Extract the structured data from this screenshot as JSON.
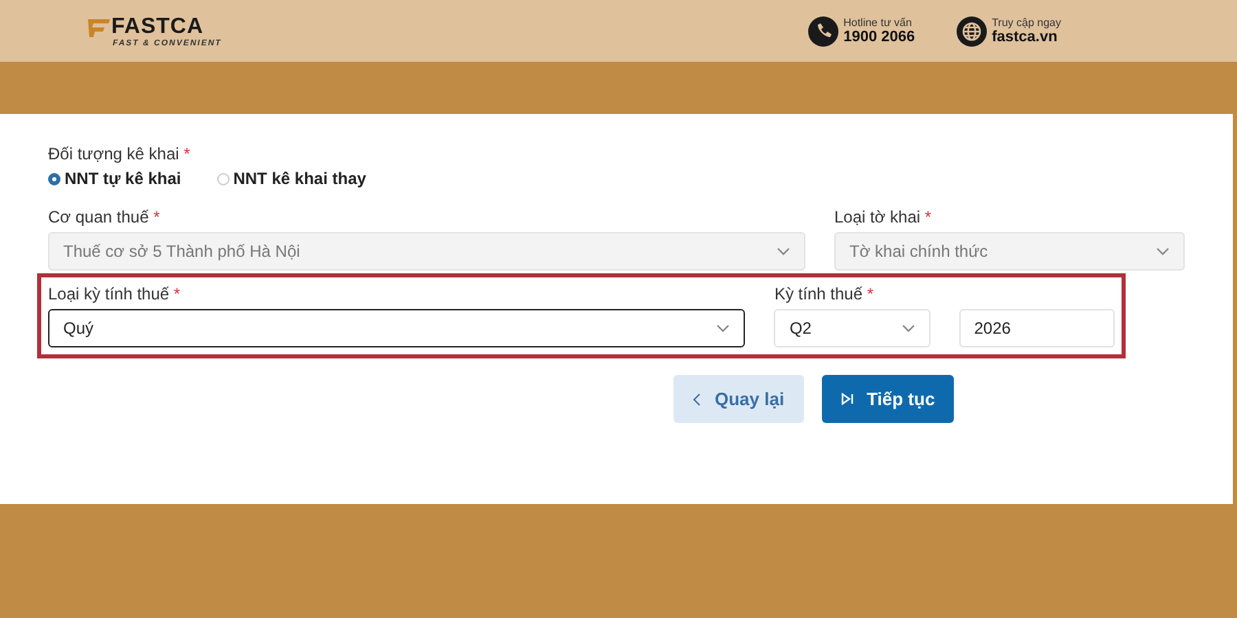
{
  "header": {
    "brand": "FASTCA",
    "tagline": "FAST & CONVENIENT",
    "contacts": [
      {
        "kind": "phone",
        "label": "Hotline tư vấn",
        "value": "1900 2066"
      },
      {
        "kind": "globe",
        "label": "Truy cập ngay",
        "value": "fastca.vn"
      }
    ]
  },
  "declarant": {
    "label": "Đối tượng kê khai",
    "mark": "*",
    "options": [
      {
        "label": "NNT tự kê khai",
        "selected": true
      },
      {
        "label": "NNT kê khai thay",
        "selected": false
      }
    ]
  },
  "rows": [
    {
      "highlighted": false,
      "fields": [
        {
          "kind": "select",
          "label": "Cơ quan thuế",
          "mark": "*",
          "value": "Thuế cơ sở 5 Thành phố Hà Nội",
          "disabled": true,
          "focused": false
        },
        {
          "kind": "select",
          "label": "Loại tờ khai",
          "mark": "*",
          "value": "Tờ khai chính thức",
          "disabled": true,
          "focused": false
        }
      ]
    },
    {
      "highlighted": true,
      "fields": [
        {
          "kind": "select",
          "label": "Loại kỳ tính thuế",
          "mark": "*",
          "value": "Quý",
          "disabled": false,
          "focused": true
        },
        {
          "kind": "select",
          "label": "Kỳ tính thuế",
          "mark": "*",
          "value": "Q2",
          "disabled": false,
          "focused": false
        },
        {
          "kind": "input",
          "value": "2026",
          "disabled": false,
          "focused": false
        }
      ]
    }
  ],
  "buttons": [
    {
      "kind": "back",
      "label": "Quay lại"
    },
    {
      "kind": "next",
      "label": "Tiếp tục"
    }
  ]
}
